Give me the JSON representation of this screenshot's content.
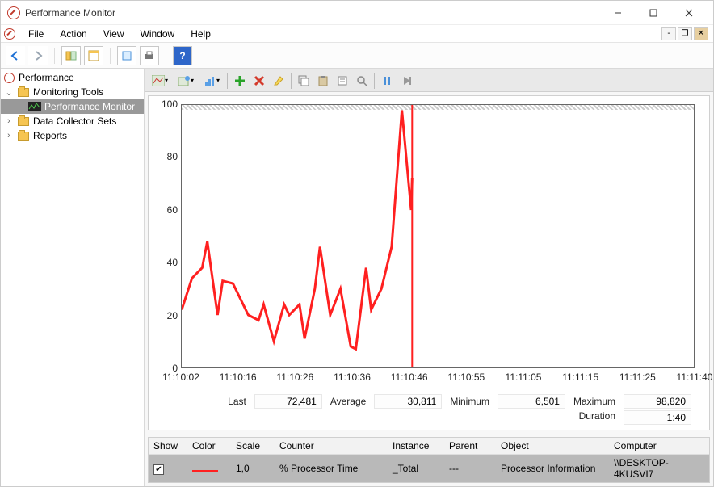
{
  "window": {
    "title": "Performance Monitor"
  },
  "menu": {
    "file": "File",
    "action": "Action",
    "view": "View",
    "window": "Window",
    "help": "Help"
  },
  "tree": {
    "root": "Performance",
    "monitoring_tools": "Monitoring Tools",
    "performance_monitor": "Performance Monitor",
    "data_collector_sets": "Data Collector Sets",
    "reports": "Reports"
  },
  "stats": {
    "labels": {
      "last": "Last",
      "avg": "Average",
      "min": "Minimum",
      "max": "Maximum",
      "duration": "Duration"
    },
    "last": "72,481",
    "avg": "30,811",
    "min": "6,501",
    "max": "98,820",
    "duration": "1:40"
  },
  "legend": {
    "headers": {
      "show": "Show",
      "color": "Color",
      "scale": "Scale",
      "counter": "Counter",
      "instance": "Instance",
      "parent": "Parent",
      "object": "Object",
      "computer": "Computer"
    },
    "rows": [
      {
        "show": true,
        "scale": "1,0",
        "counter": "% Processor Time",
        "instance": "_Total",
        "parent": "---",
        "object": "Processor Information",
        "computer": "\\\\DESKTOP-4KUSVI7"
      }
    ]
  },
  "chart_data": {
    "type": "line",
    "title": "",
    "ylabel": "",
    "xlabel": "",
    "ylim": [
      0,
      100
    ],
    "yticks": [
      0,
      20,
      40,
      60,
      80,
      100
    ],
    "x_labels": [
      "11:10:02",
      "11:10:16",
      "11:10:26",
      "11:10:36",
      "11:10:46",
      "11:10:55",
      "11:11:05",
      "11:11:15",
      "11:11:25",
      "11:11:40"
    ],
    "series": [
      {
        "name": "% Processor Time",
        "color": "#ff2020",
        "time_fraction": [
          0.0,
          0.02,
          0.04,
          0.05,
          0.07,
          0.08,
          0.1,
          0.12,
          0.13,
          0.15,
          0.16,
          0.18,
          0.2,
          0.21,
          0.23,
          0.24,
          0.26,
          0.27,
          0.29,
          0.31,
          0.33,
          0.34,
          0.36,
          0.37,
          0.39,
          0.41,
          0.43,
          0.448,
          0.45
        ],
        "values": [
          22,
          34,
          38,
          48,
          20,
          33,
          32,
          24,
          20,
          18,
          24,
          10,
          24,
          20,
          24,
          11,
          30,
          46,
          20,
          30,
          8,
          7,
          38,
          22,
          30,
          46,
          98,
          60,
          72
        ]
      }
    ],
    "current_time_fraction": 0.45
  }
}
